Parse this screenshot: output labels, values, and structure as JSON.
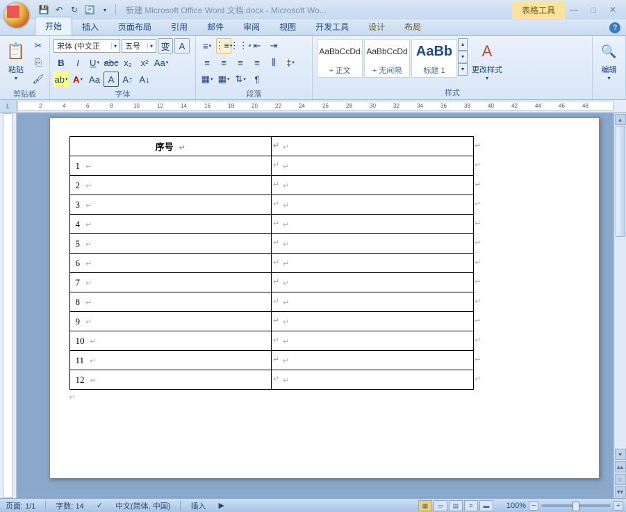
{
  "window": {
    "title": "新建 Microsoft Office Word 文档.docx - Microsoft Wo...",
    "context_tab_group": "表格工具"
  },
  "qat": [
    "save",
    "undo",
    "redo",
    "sync"
  ],
  "tabs": [
    {
      "id": "home",
      "label": "开始",
      "active": true
    },
    {
      "id": "insert",
      "label": "插入"
    },
    {
      "id": "layout",
      "label": "页面布局"
    },
    {
      "id": "ref",
      "label": "引用"
    },
    {
      "id": "mail",
      "label": "邮件"
    },
    {
      "id": "review",
      "label": "审阅"
    },
    {
      "id": "view",
      "label": "视图"
    },
    {
      "id": "dev",
      "label": "开发工具"
    },
    {
      "id": "design",
      "label": "设计",
      "context": true
    },
    {
      "id": "tlayout",
      "label": "布局",
      "context": true
    }
  ],
  "ribbon": {
    "clipboard": {
      "label": "剪贴板",
      "paste": "粘贴"
    },
    "font": {
      "label": "字体",
      "name": "宋体 (中文正",
      "size": "五号"
    },
    "paragraph": {
      "label": "段落"
    },
    "styles": {
      "label": "样式",
      "change": "更改样式",
      "items": [
        {
          "preview": "AaBbCcDd",
          "name": "+ 正文"
        },
        {
          "preview": "AaBbCcDd",
          "name": "+ 无间隔"
        },
        {
          "preview": "AaBb",
          "name": "标题 1",
          "big": true
        }
      ]
    },
    "editing": {
      "label": "编辑"
    }
  },
  "ruler_marks": [
    2,
    4,
    6,
    8,
    10,
    12,
    14,
    16,
    18,
    20,
    22,
    24,
    26,
    28,
    30,
    32,
    34,
    36,
    38,
    40,
    42,
    44,
    46,
    48
  ],
  "document": {
    "header_col1": "序号",
    "rows": [
      {
        "n": "1"
      },
      {
        "n": "2"
      },
      {
        "n": "3"
      },
      {
        "n": "4"
      },
      {
        "n": "5"
      },
      {
        "n": "6"
      },
      {
        "n": "7"
      },
      {
        "n": "8"
      },
      {
        "n": "9"
      },
      {
        "n": "10"
      },
      {
        "n": "11"
      },
      {
        "n": "12"
      }
    ]
  },
  "status": {
    "page": "页面: 1/1",
    "words": "字数: 14",
    "lang": "中文(简体, 中国)",
    "mode": "插入",
    "zoom": "100%"
  }
}
